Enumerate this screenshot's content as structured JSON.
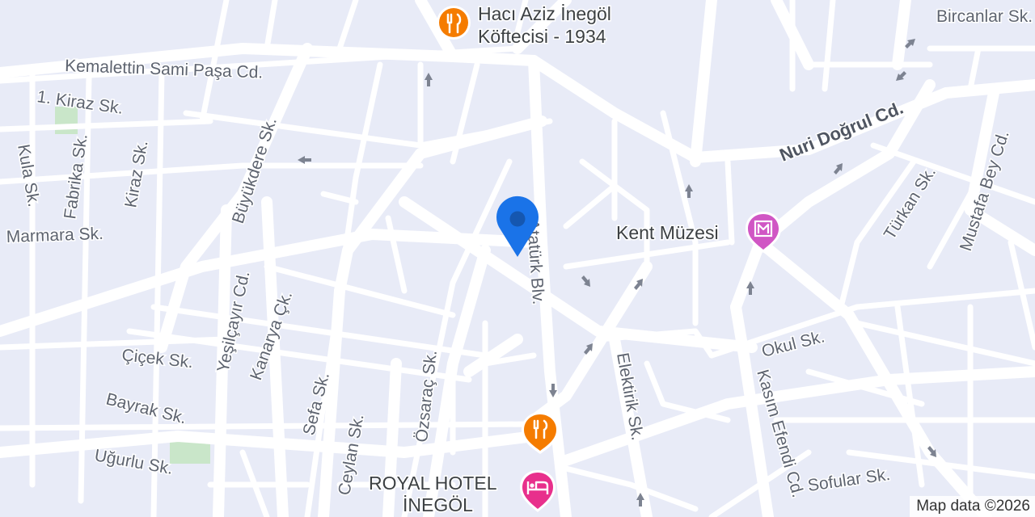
{
  "map": {
    "background_color": "#e8ebf7",
    "road_color": "#ffffff",
    "park_color": "#c9e6c9",
    "attribution": "Map data ©2026",
    "street_labels": {
      "kemalettin": "Kemalettin Sami Paşa Cd.",
      "bircanlar": "Bircanlar Sk.",
      "kiraz1": "1. Kiraz Sk.",
      "kula": "Kula Sk.",
      "fabrika": "Fabrika Sk.",
      "kiraz": "Kiraz Sk.",
      "marmara": "Marmara Sk.",
      "buyukdere": "Büyükdere Sk.",
      "nuri": "Nuri Doğrul Cd.",
      "mustafa": "Mustafa Bey Cd.",
      "turkan": "Türkan Sk.",
      "ataturk": "Atatürk Blv.",
      "yesilcayir": "Yeşilçayır Cd.",
      "kanarya": "Kanarya Çk.",
      "ozsarac": "Özsaraç Sk.",
      "sefa": "Sefa Sk.",
      "cicek": "Çiçek Sk.",
      "bayrak": "Bayrak Sk.",
      "ceylan": "Ceylan Sk.",
      "ugurlu": "Uğurlu Sk.",
      "elektirik": "Elektirik Sk.",
      "okul": "Okul Sk.",
      "kasim": "Kasım Efendi Cd.",
      "sofular": "Sofular Sk."
    },
    "pois": {
      "haci_aziz": {
        "line1": "Hacı Aziz İnegöl",
        "line2": "Köftecisi - 1934",
        "icon": "restaurant-icon",
        "color": "#f57c00"
      },
      "kent_muzesi": {
        "label": "Kent Müzesi",
        "icon": "museum-icon",
        "color": "#d056c4"
      },
      "restaurant2": {
        "icon": "restaurant-icon",
        "color": "#f57c00"
      },
      "royal_hotel": {
        "line1": "ROYAL HOTEL",
        "line2": "İNEGÖL",
        "icon": "hotel-icon",
        "color": "#e8308c"
      }
    },
    "location_pin": {
      "icon": "location-pin-icon",
      "color": "#1a73e8"
    }
  }
}
